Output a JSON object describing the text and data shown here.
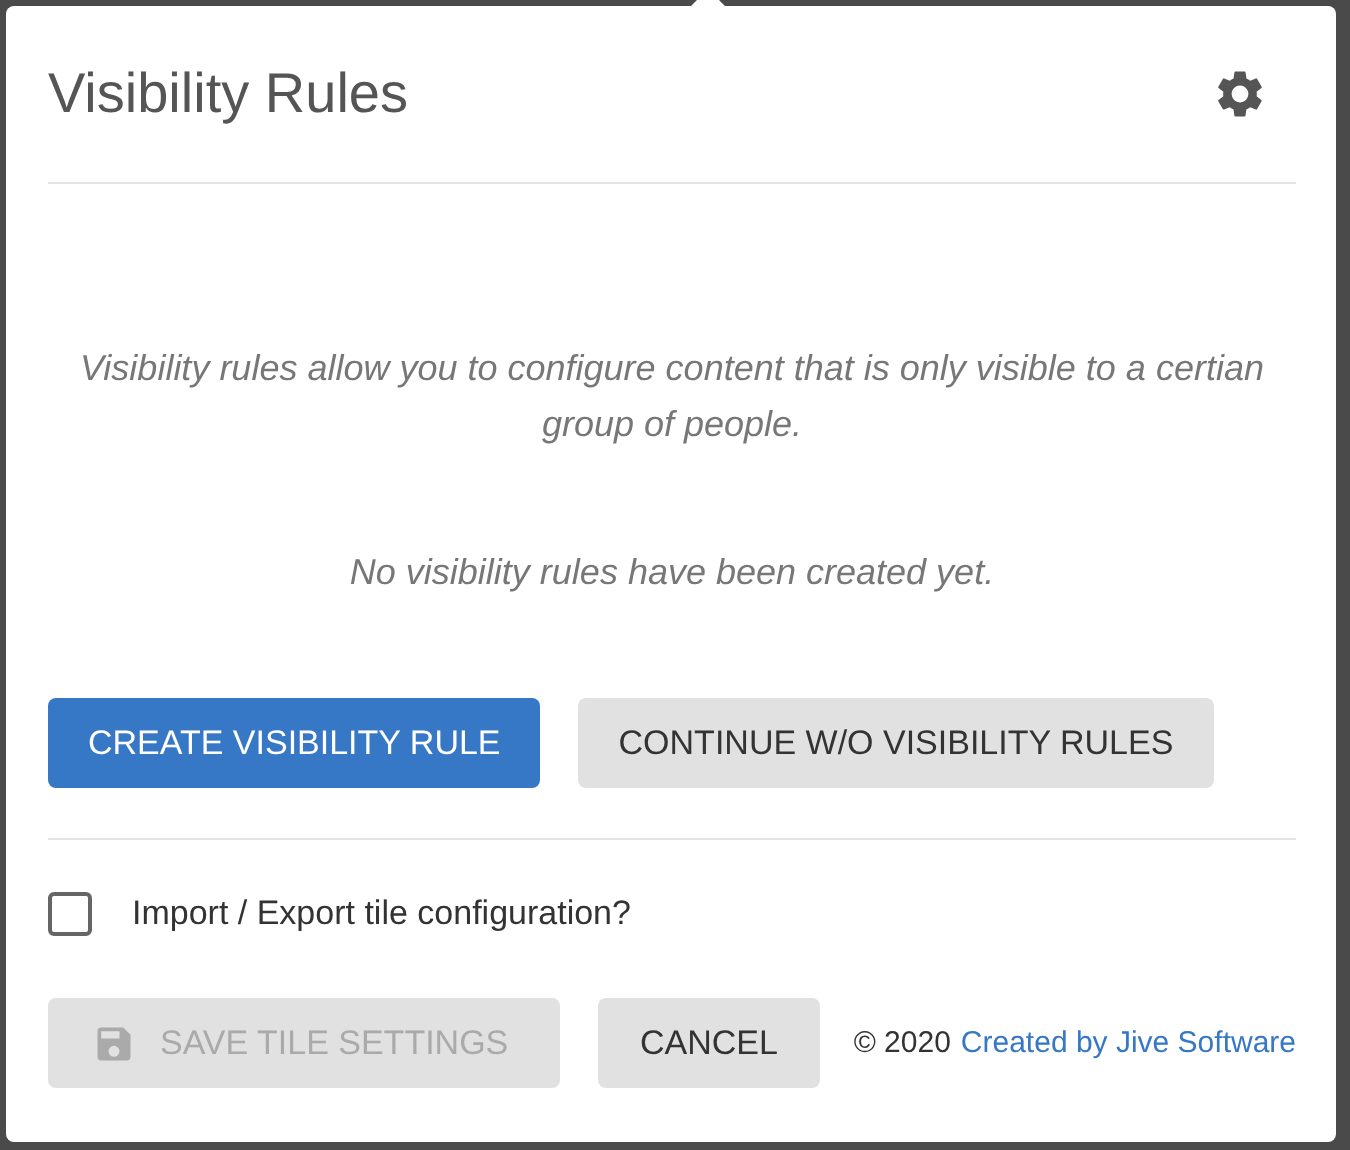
{
  "dialog": {
    "title": "Visibility Rules"
  },
  "intro": "Visibility rules allow you to configure content that is only visible to a certian group of people.",
  "empty_message": "No visibility rules have been created yet.",
  "actions": [
    {
      "label": "CREATE VISIBILITY RULE",
      "kind": "primary"
    },
    {
      "label": "CONTINUE W/O VISIBILITY RULES",
      "kind": "secondary"
    }
  ],
  "import_export": {
    "label": "Import / Export tile configuration?",
    "checked": false
  },
  "footer": {
    "save": {
      "label": "SAVE TILE SETTINGS",
      "disabled": true
    },
    "cancel": {
      "label": "CANCEL"
    },
    "copyright": "© 2020",
    "link": "Created by Jive Software"
  }
}
